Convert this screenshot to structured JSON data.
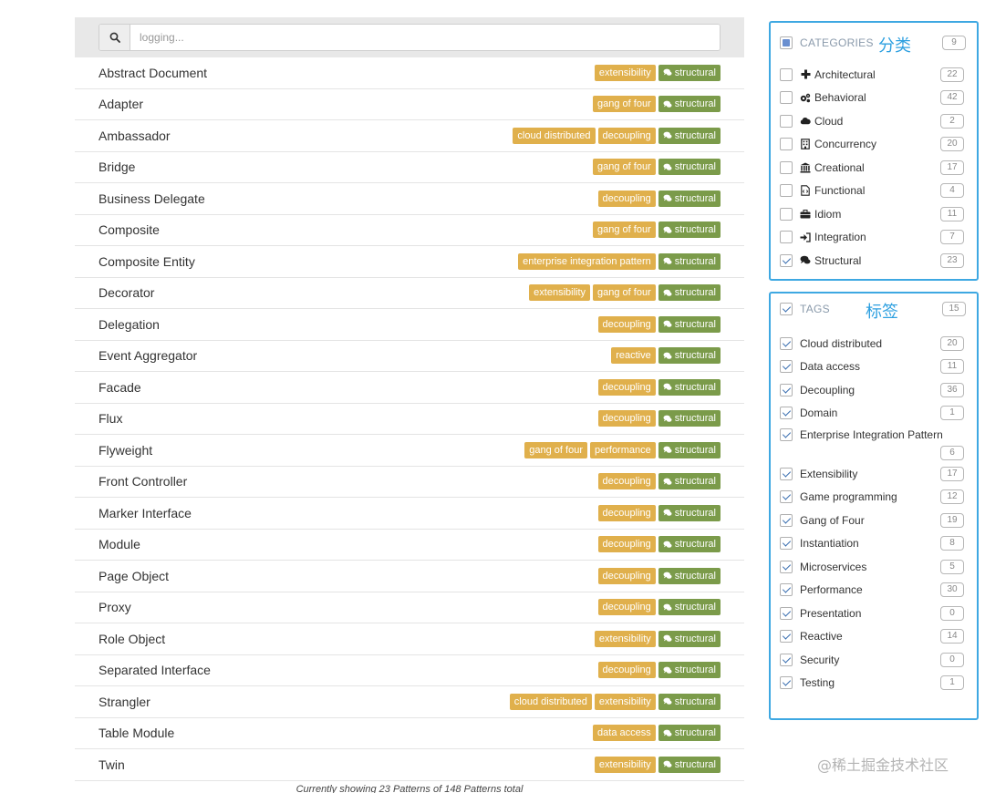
{
  "search": {
    "placeholder": "logging..."
  },
  "patterns": [
    {
      "name": "Abstract Document",
      "tags": [
        "extensibility"
      ],
      "category": "structural"
    },
    {
      "name": "Adapter",
      "tags": [
        "gang of four"
      ],
      "category": "structural"
    },
    {
      "name": "Ambassador",
      "tags": [
        "cloud distributed",
        "decoupling"
      ],
      "category": "structural"
    },
    {
      "name": "Bridge",
      "tags": [
        "gang of four"
      ],
      "category": "structural"
    },
    {
      "name": "Business Delegate",
      "tags": [
        "decoupling"
      ],
      "category": "structural"
    },
    {
      "name": "Composite",
      "tags": [
        "gang of four"
      ],
      "category": "structural"
    },
    {
      "name": "Composite Entity",
      "tags": [
        "enterprise integration pattern"
      ],
      "category": "structural"
    },
    {
      "name": "Decorator",
      "tags": [
        "extensibility",
        "gang of four"
      ],
      "category": "structural"
    },
    {
      "name": "Delegation",
      "tags": [
        "decoupling"
      ],
      "category": "structural"
    },
    {
      "name": "Event Aggregator",
      "tags": [
        "reactive"
      ],
      "category": "structural"
    },
    {
      "name": "Facade",
      "tags": [
        "decoupling"
      ],
      "category": "structural"
    },
    {
      "name": "Flux",
      "tags": [
        "decoupling"
      ],
      "category": "structural"
    },
    {
      "name": "Flyweight",
      "tags": [
        "gang of four",
        "performance"
      ],
      "category": "structural"
    },
    {
      "name": "Front Controller",
      "tags": [
        "decoupling"
      ],
      "category": "structural"
    },
    {
      "name": "Marker Interface",
      "tags": [
        "decoupling"
      ],
      "category": "structural"
    },
    {
      "name": "Module",
      "tags": [
        "decoupling"
      ],
      "category": "structural"
    },
    {
      "name": "Page Object",
      "tags": [
        "decoupling"
      ],
      "category": "structural"
    },
    {
      "name": "Proxy",
      "tags": [
        "decoupling"
      ],
      "category": "structural"
    },
    {
      "name": "Role Object",
      "tags": [
        "extensibility"
      ],
      "category": "structural"
    },
    {
      "name": "Separated Interface",
      "tags": [
        "decoupling"
      ],
      "category": "structural"
    },
    {
      "name": "Strangler",
      "tags": [
        "cloud distributed",
        "extensibility"
      ],
      "category": "structural"
    },
    {
      "name": "Table Module",
      "tags": [
        "data access"
      ],
      "category": "structural"
    },
    {
      "name": "Twin",
      "tags": [
        "extensibility"
      ],
      "category": "structural"
    }
  ],
  "footer": "Currently showing 23 Patterns of 148 Patterns total",
  "categories": {
    "title": "CATEGORIES",
    "annotation": "分类",
    "count": "9",
    "items": [
      {
        "label": "Architectural",
        "count": "22",
        "checked": false,
        "icon": "plus-icon"
      },
      {
        "label": "Behavioral",
        "count": "42",
        "checked": false,
        "icon": "cogs-icon"
      },
      {
        "label": "Cloud",
        "count": "2",
        "checked": false,
        "icon": "cloud-icon"
      },
      {
        "label": "Concurrency",
        "count": "20",
        "checked": false,
        "icon": "building-icon"
      },
      {
        "label": "Creational",
        "count": "17",
        "checked": false,
        "icon": "bank-icon"
      },
      {
        "label": "Functional",
        "count": "4",
        "checked": false,
        "icon": "file-code-icon"
      },
      {
        "label": "Idiom",
        "count": "11",
        "checked": false,
        "icon": "briefcase-icon"
      },
      {
        "label": "Integration",
        "count": "7",
        "checked": false,
        "icon": "sign-in-icon"
      },
      {
        "label": "Structural",
        "count": "23",
        "checked": true,
        "icon": "comments-icon"
      }
    ]
  },
  "tags": {
    "title": "TAGS",
    "annotation": "标签",
    "count": "15",
    "items": [
      {
        "label": "Cloud distributed",
        "count": "20",
        "checked": true
      },
      {
        "label": "Data access",
        "count": "11",
        "checked": true
      },
      {
        "label": "Decoupling",
        "count": "36",
        "checked": true
      },
      {
        "label": "Domain",
        "count": "1",
        "checked": true
      },
      {
        "label": "Enterprise Integration Pattern",
        "count": "6",
        "checked": true
      },
      {
        "label": "Extensibility",
        "count": "17",
        "checked": true
      },
      {
        "label": "Game programming",
        "count": "12",
        "checked": true
      },
      {
        "label": "Gang of Four",
        "count": "19",
        "checked": true
      },
      {
        "label": "Instantiation",
        "count": "8",
        "checked": true
      },
      {
        "label": "Microservices",
        "count": "5",
        "checked": true
      },
      {
        "label": "Performance",
        "count": "30",
        "checked": true
      },
      {
        "label": "Presentation",
        "count": "0",
        "checked": true
      },
      {
        "label": "Reactive",
        "count": "14",
        "checked": true
      },
      {
        "label": "Security",
        "count": "0",
        "checked": true
      },
      {
        "label": "Testing",
        "count": "1",
        "checked": true
      }
    ]
  },
  "watermark": "@稀土掘金技术社区",
  "colors": {
    "tag_badge": "#e0b04c",
    "category_badge": "#7b9b4a",
    "panel_border": "#3ea8e2",
    "annotation": "#2ea0e0"
  }
}
